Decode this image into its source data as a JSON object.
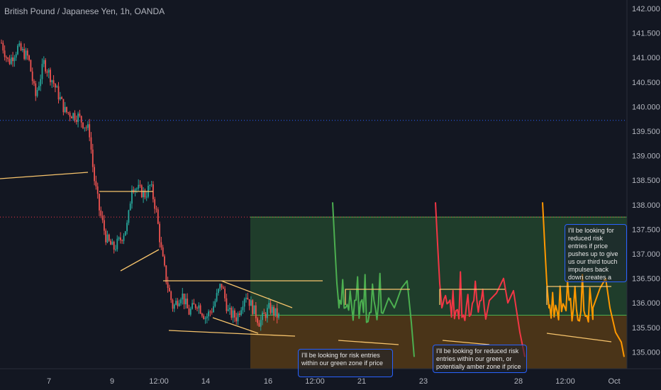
{
  "title": "British Pound / Japanese Yen, 1h, OANDA",
  "chart_data": {
    "type": "candlestick",
    "yaxis": {
      "ticks": [
        "142.000",
        "141.500",
        "141.000",
        "140.500",
        "140.000",
        "139.500",
        "139.000",
        "138.500",
        "138.000",
        "137.500",
        "137.000",
        "136.500",
        "136.000",
        "135.500",
        "135.000"
      ],
      "ylim": [
        134.85,
        142.15
      ]
    },
    "xaxis": {
      "ticks": [
        "7",
        "9",
        "12:00",
        "14",
        "16",
        "12:00",
        "21",
        "23",
        "28",
        "12:00",
        "Oct"
      ]
    },
    "colors": {
      "up": "#26a69a",
      "down": "#ef5350",
      "trend": "#f7c46c",
      "green": "#4caf50",
      "red": "#f23645",
      "orange": "#ff9800",
      "blue": "#2962ff"
    },
    "horizontal_lines": [
      {
        "price": 139.72,
        "color": "#2962ff",
        "style": "dotted"
      },
      {
        "price": 137.75,
        "color": "#f23645",
        "style": "dotted"
      }
    ],
    "zones": [
      {
        "name": "green zone",
        "from": 135.75,
        "to": 137.75,
        "color": "#1f3d2b"
      },
      {
        "name": "amber zone",
        "from": 134.8,
        "to": 135.75,
        "color": "#4a3418"
      }
    ],
    "annotations": [
      "I'll be looking for risk entries within our green zone if price",
      "I'll be looking for reduced risk entries within our green, or potentially amber zone if price",
      "I'll be looking for reduced risk entries if price pushes up to give us our third touch impulses back down creates a one hover either through or below structure."
    ]
  }
}
